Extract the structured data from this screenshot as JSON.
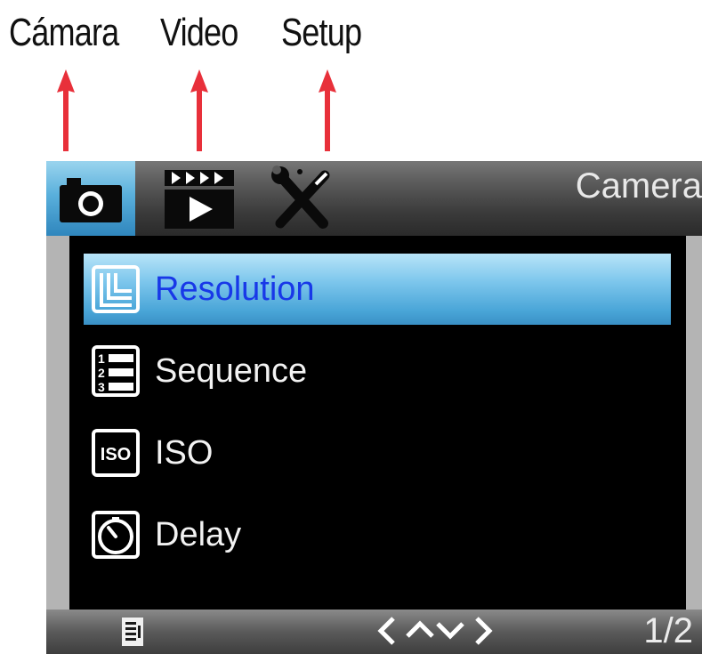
{
  "callouts": [
    {
      "label": "Cámara"
    },
    {
      "label": "Video"
    },
    {
      "label": "Setup"
    }
  ],
  "colors": {
    "arrow": "#e8303a",
    "selected_text": "#1838e8",
    "selected_bg": "#7cc6ec"
  },
  "topbar": {
    "tabs": [
      {
        "name": "camera",
        "icon": "camera-icon"
      },
      {
        "name": "video",
        "icon": "video-clapper-icon"
      },
      {
        "name": "setup",
        "icon": "tools-icon"
      }
    ],
    "title": "Camera"
  },
  "menu": {
    "items": [
      {
        "label": "Resolution",
        "icon": "resolution-icon",
        "selected": true
      },
      {
        "label": "Sequence",
        "icon": "sequence-icon",
        "selected": false
      },
      {
        "label": "ISO",
        "icon": "iso-icon",
        "selected": false
      },
      {
        "label": "Delay",
        "icon": "delay-timer-icon",
        "selected": false
      }
    ]
  },
  "bottombar": {
    "icon": "list-icon",
    "nav_icon": "navigation-arrows-icon",
    "page": "1/2"
  },
  "iso_badge_text": "ISO"
}
